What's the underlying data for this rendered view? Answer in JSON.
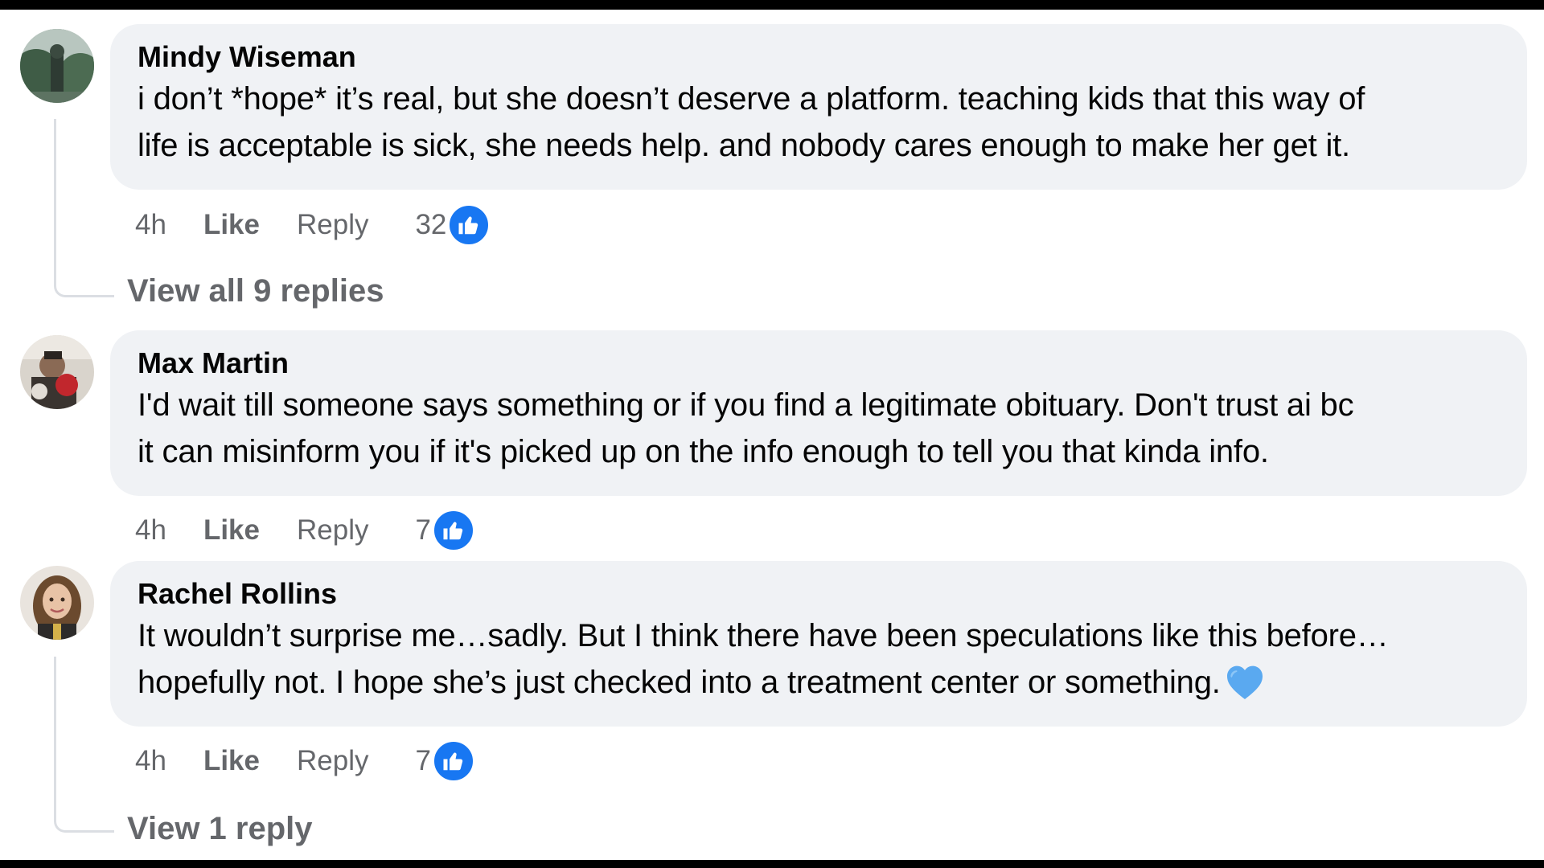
{
  "comments": [
    {
      "author": "Mindy Wiseman",
      "text_line1": "i don’t *hope* it’s real, but she doesn’t deserve a platform. teaching kids that this way of",
      "text_line2": "life is acceptable is sick, she needs help. and nobody cares enough to make her get it.",
      "time": "4h",
      "like_label": "Like",
      "reply_label": "Reply",
      "reaction_count": "32",
      "view_replies": "View all 9 replies"
    },
    {
      "author": "Max Martin",
      "text_line1": "I'd wait till someone says something or if you find a legitimate obituary. Don't trust ai bc",
      "text_line2": "it can misinform you if it's picked up on the info enough to tell you that kinda info.",
      "time": "4h",
      "like_label": "Like",
      "reply_label": "Reply",
      "reaction_count": "7"
    },
    {
      "author": "Rachel Rollins",
      "text_line1": "It wouldn’t surprise me…sadly. But I think there have been speculations like this before…",
      "text_line2": "hopefully not. I hope she’s just checked into a treatment center or something.",
      "emoji": "blue-heart",
      "time": "4h",
      "like_label": "Like",
      "reply_label": "Reply",
      "reaction_count": "7",
      "view_replies": "View 1 reply"
    }
  ],
  "colors": {
    "bubble": "#f0f2f5",
    "meta_text": "#65676b",
    "like_blue": "#1877f2",
    "thread_line": "#dbdee3"
  },
  "icons": {
    "reaction": "thumbs-up-icon",
    "emoji": "blue-heart-icon"
  }
}
